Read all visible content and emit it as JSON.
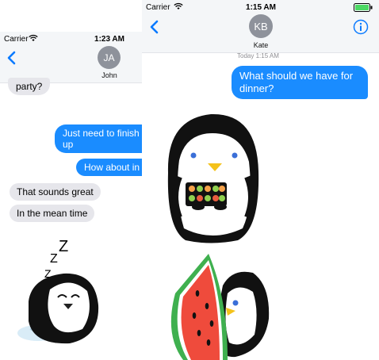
{
  "left_screen": {
    "status": {
      "carrier": "Carrier",
      "time": "1:23 AM"
    },
    "contact": {
      "initials": "JA",
      "name": "John"
    },
    "messages": [
      {
        "text": "party?",
        "dir": "in"
      },
      {
        "text": "Just need to finish up",
        "dir": "out"
      },
      {
        "text": "How about in",
        "dir": "out"
      },
      {
        "text": "That sounds great",
        "dir": "in"
      },
      {
        "text": "In the mean time",
        "dir": "in"
      }
    ],
    "sticker": {
      "name": "sleeping-penguin-sticker",
      "zzz": "Z Z Z"
    }
  },
  "right_screen": {
    "status": {
      "carrier": "Carrier",
      "time": "1:15 AM"
    },
    "contact": {
      "initials": "KB",
      "name": "Kate"
    },
    "timestamp": "Today 1:15 AM",
    "messages": [
      {
        "text": "What should we have for dinner?",
        "dir": "out"
      }
    ],
    "stickers": [
      {
        "name": "penguin-sushi-sticker"
      },
      {
        "name": "penguin-watermelon-sticker"
      }
    ]
  },
  "colors": {
    "accent": "#0a7aff",
    "outgoing_bubble": "#1a8cff",
    "incoming_bubble": "#e6e6eb",
    "avatar": "#8e929b",
    "battery": "#4cd964"
  },
  "icons": [
    "back-chevron-icon",
    "wifi-icon",
    "info-icon",
    "battery-icon"
  ]
}
